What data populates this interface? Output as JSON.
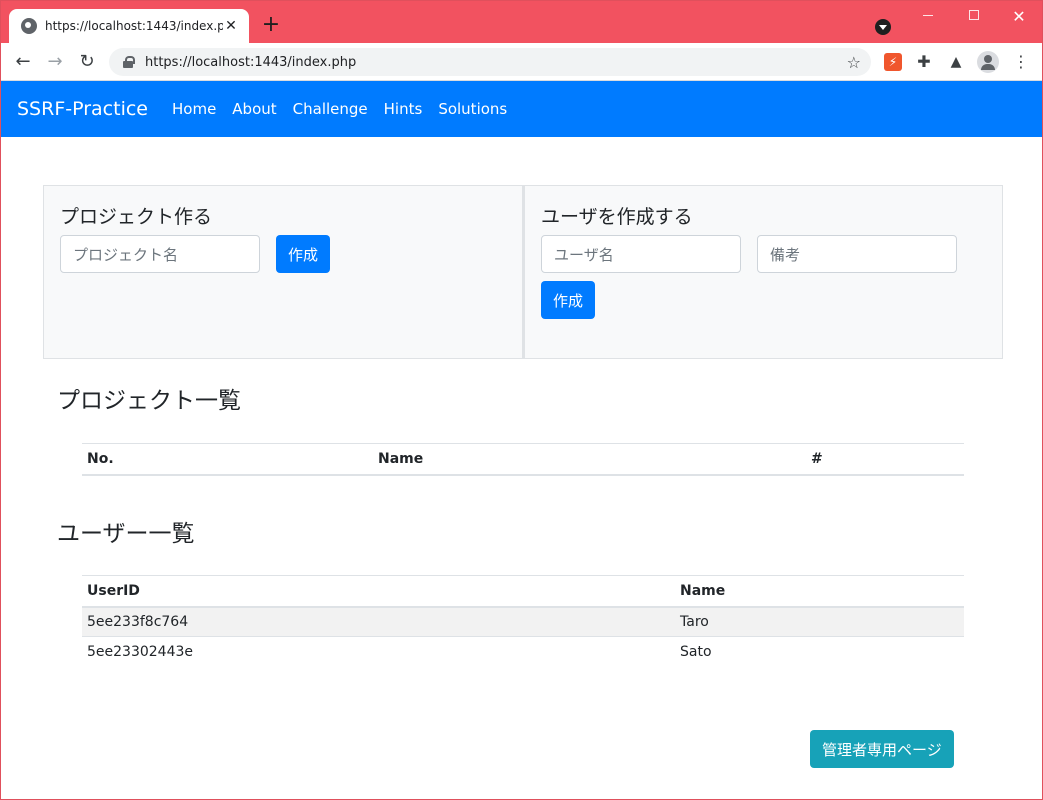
{
  "browser": {
    "tab_title": "https://localhost:1443/index.php",
    "tab_close": "✕",
    "new_tab": "+",
    "url": "https://localhost:1443/index.php",
    "back": "←",
    "forward": "→",
    "reload": "↻",
    "star": "☆",
    "kebab": "⋮",
    "window_close": "✕"
  },
  "navbar": {
    "brand": "SSRF-Practice",
    "links": [
      "Home",
      "About",
      "Challenge",
      "Hints",
      "Solutions"
    ],
    "color": "#007bff"
  },
  "project_form": {
    "title": "プロジェクト作る",
    "name_placeholder": "プロジェクト名",
    "submit_label": "作成"
  },
  "user_form": {
    "title": "ユーザを作成する",
    "name_placeholder": "ユーザ名",
    "note_placeholder": "備考",
    "submit_label": "作成"
  },
  "project_list": {
    "title": "プロジェクト一覧",
    "columns": [
      "No.",
      "Name",
      "#"
    ],
    "rows": []
  },
  "user_list": {
    "title": "ユーザー一覧",
    "columns": [
      "UserID",
      "Name"
    ],
    "rows": [
      [
        "5ee233f8c764",
        "Taro"
      ],
      [
        "5ee23302443e",
        "Sato"
      ]
    ]
  },
  "admin_button": {
    "label": "管理者専用ページ",
    "color": "#17a2b8"
  }
}
